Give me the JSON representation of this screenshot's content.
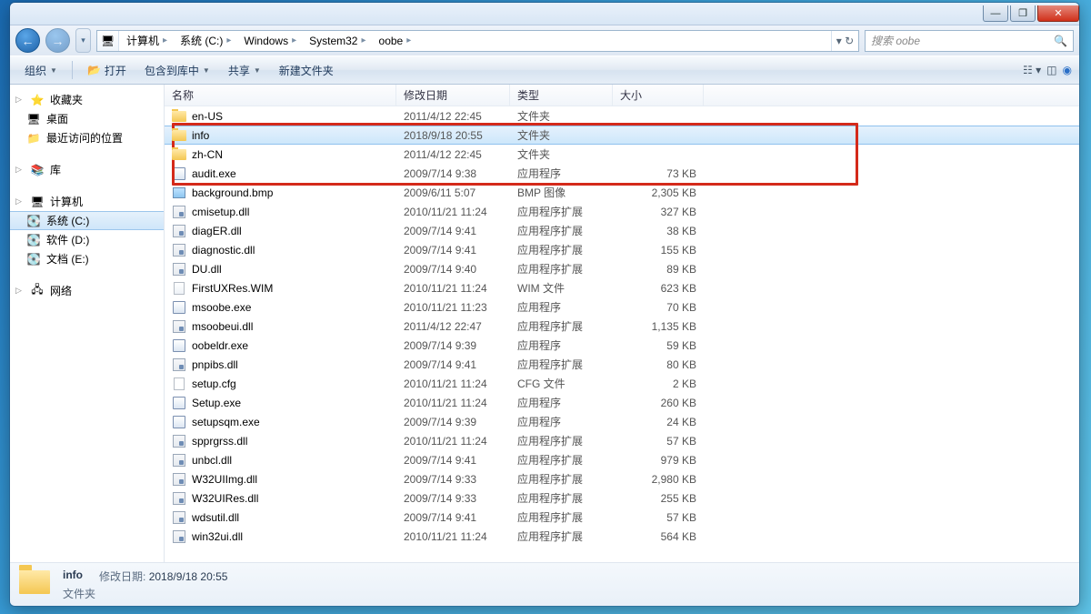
{
  "titlebar": {
    "min": "—",
    "max": "❐",
    "close": "✕"
  },
  "nav": {
    "back": "←",
    "fwd": "→"
  },
  "breadcrumbs": [
    "计算机",
    "系统 (C:)",
    "Windows",
    "System32",
    "oobe"
  ],
  "search": {
    "placeholder": "搜索 oobe"
  },
  "toolbar": {
    "organize": "组织",
    "open": "打开",
    "include": "包含到库中",
    "share": "共享",
    "newfolder": "新建文件夹"
  },
  "columns": {
    "name": "名称",
    "date": "修改日期",
    "type": "类型",
    "size": "大小"
  },
  "sidebar": {
    "fav": {
      "head": "收藏夹",
      "items": [
        "桌面",
        "最近访问的位置"
      ]
    },
    "lib": {
      "head": "库"
    },
    "pc": {
      "head": "计算机",
      "items": [
        "系统 (C:)",
        "软件 (D:)",
        "文档 (E:)"
      ]
    },
    "net": {
      "head": "网络"
    }
  },
  "files": [
    {
      "icon": "folder",
      "name": "en-US",
      "date": "2011/4/12 22:45",
      "type": "文件夹",
      "size": ""
    },
    {
      "icon": "folder",
      "name": "info",
      "date": "2018/9/18 20:55",
      "type": "文件夹",
      "size": "",
      "selected": true
    },
    {
      "icon": "folder",
      "name": "zh-CN",
      "date": "2011/4/12 22:45",
      "type": "文件夹",
      "size": ""
    },
    {
      "icon": "exe",
      "name": "audit.exe",
      "date": "2009/7/14 9:38",
      "type": "应用程序",
      "size": "73 KB"
    },
    {
      "icon": "img",
      "name": "background.bmp",
      "date": "2009/6/11 5:07",
      "type": "BMP 图像",
      "size": "2,305 KB"
    },
    {
      "icon": "dll",
      "name": "cmisetup.dll",
      "date": "2010/11/21 11:24",
      "type": "应用程序扩展",
      "size": "327 KB"
    },
    {
      "icon": "dll",
      "name": "diagER.dll",
      "date": "2009/7/14 9:41",
      "type": "应用程序扩展",
      "size": "38 KB"
    },
    {
      "icon": "dll",
      "name": "diagnostic.dll",
      "date": "2009/7/14 9:41",
      "type": "应用程序扩展",
      "size": "155 KB"
    },
    {
      "icon": "dll",
      "name": "DU.dll",
      "date": "2009/7/14 9:40",
      "type": "应用程序扩展",
      "size": "89 KB"
    },
    {
      "icon": "wim",
      "name": "FirstUXRes.WIM",
      "date": "2010/11/21 11:24",
      "type": "WIM 文件",
      "size": "623 KB"
    },
    {
      "icon": "exe",
      "name": "msoobe.exe",
      "date": "2010/11/21 11:23",
      "type": "应用程序",
      "size": "70 KB"
    },
    {
      "icon": "dll",
      "name": "msoobeui.dll",
      "date": "2011/4/12 22:47",
      "type": "应用程序扩展",
      "size": "1,135 KB"
    },
    {
      "icon": "exe",
      "name": "oobeldr.exe",
      "date": "2009/7/14 9:39",
      "type": "应用程序",
      "size": "59 KB"
    },
    {
      "icon": "dll",
      "name": "pnpibs.dll",
      "date": "2009/7/14 9:41",
      "type": "应用程序扩展",
      "size": "80 KB"
    },
    {
      "icon": "cfg",
      "name": "setup.cfg",
      "date": "2010/11/21 11:24",
      "type": "CFG 文件",
      "size": "2 KB"
    },
    {
      "icon": "exe",
      "name": "Setup.exe",
      "date": "2010/11/21 11:24",
      "type": "应用程序",
      "size": "260 KB"
    },
    {
      "icon": "exe",
      "name": "setupsqm.exe",
      "date": "2009/7/14 9:39",
      "type": "应用程序",
      "size": "24 KB"
    },
    {
      "icon": "dll",
      "name": "spprgrss.dll",
      "date": "2010/11/21 11:24",
      "type": "应用程序扩展",
      "size": "57 KB"
    },
    {
      "icon": "dll",
      "name": "unbcl.dll",
      "date": "2009/7/14 9:41",
      "type": "应用程序扩展",
      "size": "979 KB"
    },
    {
      "icon": "dll",
      "name": "W32UIImg.dll",
      "date": "2009/7/14 9:33",
      "type": "应用程序扩展",
      "size": "2,980 KB"
    },
    {
      "icon": "dll",
      "name": "W32UIRes.dll",
      "date": "2009/7/14 9:33",
      "type": "应用程序扩展",
      "size": "255 KB"
    },
    {
      "icon": "dll",
      "name": "wdsutil.dll",
      "date": "2009/7/14 9:41",
      "type": "应用程序扩展",
      "size": "57 KB"
    },
    {
      "icon": "dll",
      "name": "win32ui.dll",
      "date": "2010/11/21 11:24",
      "type": "应用程序扩展",
      "size": "564 KB"
    }
  ],
  "status": {
    "name": "info",
    "datelbl": "修改日期:",
    "date": "2018/9/18 20:55",
    "type": "文件夹"
  }
}
